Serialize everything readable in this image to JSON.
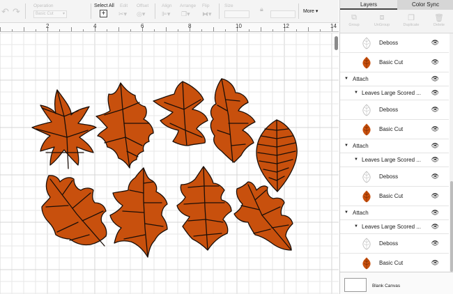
{
  "toolbar": {
    "operation_label": "Operation",
    "operation_value": "Basic Cut",
    "select_all_label": "Select All",
    "edit_label": "Edit",
    "offset_label": "Offset",
    "align_label": "Align",
    "arrange_label": "Arrange",
    "flip_label": "Flip",
    "size_label": "Size",
    "more_label": "More",
    "icons": [
      "undo-icon",
      "redo-icon",
      "select-all-icon",
      "edit-icon",
      "offset-icon",
      "align-icon",
      "arrange-icon",
      "flip-icon",
      "lock-icon",
      "chevron-down-icon"
    ]
  },
  "ruler": {
    "labels": [
      "2",
      "4",
      "6",
      "8",
      "10",
      "12",
      "14"
    ]
  },
  "colors": {
    "leaf_fill": "#c8500d",
    "leaf_stroke": "#1a0e08",
    "grid": "#e7e7e7",
    "panel_tab": "#d6d6d6"
  },
  "panel": {
    "tabs": [
      "Layers",
      "Color Sync"
    ],
    "actions": [
      "Group",
      "UnGroup",
      "Duplicate",
      "Delete"
    ],
    "layers": [
      {
        "type": "child",
        "label": "Deboss"
      },
      {
        "type": "child",
        "label": "Basic Cut"
      },
      {
        "type": "attach",
        "label": "Attach"
      },
      {
        "type": "group",
        "label": "Leaves Large Scored ..."
      },
      {
        "type": "child",
        "label": "Deboss"
      },
      {
        "type": "child",
        "label": "Basic Cut"
      },
      {
        "type": "attach",
        "label": "Attach"
      },
      {
        "type": "group",
        "label": "Leaves Large Scored ..."
      },
      {
        "type": "child",
        "label": "Deboss"
      },
      {
        "type": "child",
        "label": "Basic Cut"
      },
      {
        "type": "attach",
        "label": "Attach"
      },
      {
        "type": "group",
        "label": "Leaves Large Scored ..."
      },
      {
        "type": "child",
        "label": "Deboss"
      },
      {
        "type": "child",
        "label": "Basic Cut"
      }
    ],
    "blank_canvas_label": "Blank Canvas"
  }
}
